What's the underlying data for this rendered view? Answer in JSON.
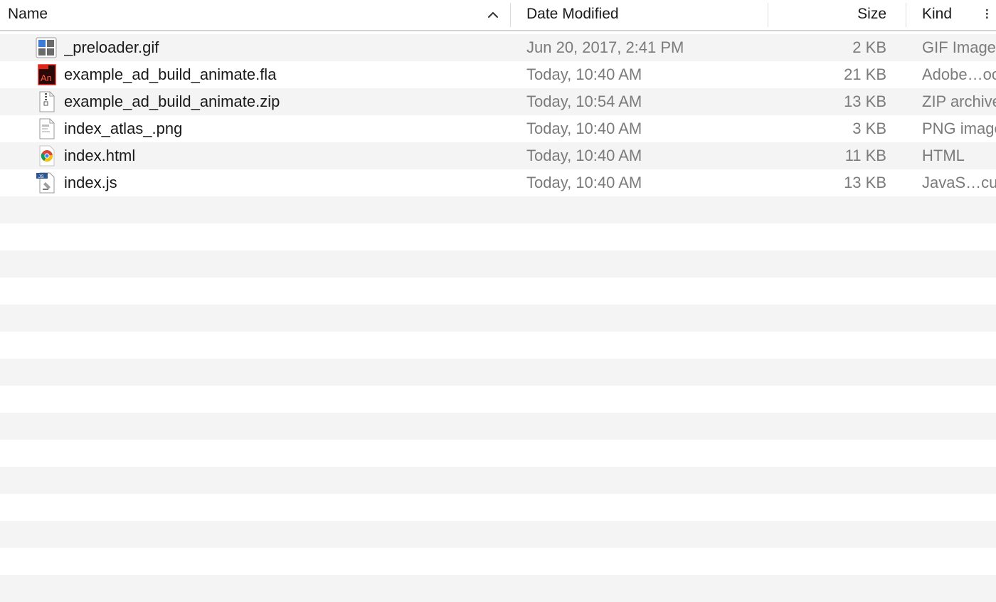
{
  "columns": {
    "name": "Name",
    "date_modified": "Date Modified",
    "size": "Size",
    "kind": "Kind"
  },
  "sort": {
    "column": "name",
    "direction": "ascending",
    "icon": "chevron-up-icon"
  },
  "files": [
    {
      "name": "_preloader.gif",
      "date": "Jun 20, 2017, 2:41 PM",
      "size": "2 KB",
      "kind": "GIF Image",
      "icon": "gif-image-icon"
    },
    {
      "name": "example_ad_build_animate.fla",
      "date": "Today, 10:40 AM",
      "size": "21 KB",
      "kind": "Adobe…ocument",
      "icon": "adobe-animate-icon"
    },
    {
      "name": "example_ad_build_animate.zip",
      "date": "Today, 10:54 AM",
      "size": "13 KB",
      "kind": "ZIP archive",
      "icon": "zip-archive-icon"
    },
    {
      "name": "index_atlas_.png",
      "date": "Today, 10:40 AM",
      "size": "3 KB",
      "kind": "PNG image",
      "icon": "png-image-icon"
    },
    {
      "name": "index.html",
      "date": "Today, 10:40 AM",
      "size": "11 KB",
      "kind": "HTML",
      "icon": "chrome-html-icon"
    },
    {
      "name": "index.js",
      "date": "Today, 10:40 AM",
      "size": "13 KB",
      "kind": "JavaS…cument",
      "icon": "javascript-file-icon"
    }
  ],
  "empty_rows": 15,
  "colors": {
    "row_alt": "#f4f4f4",
    "row_base": "#ffffff",
    "header_border": "#d4d4d4",
    "primary_text": "#1a1a1a",
    "secondary_text": "#7b7b7b"
  }
}
